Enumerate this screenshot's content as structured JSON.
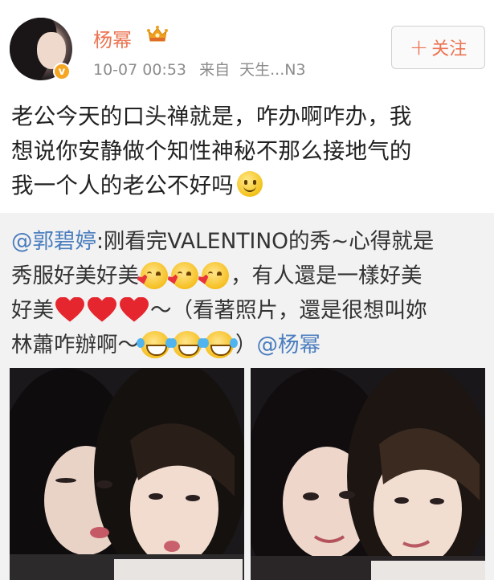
{
  "post": {
    "username": "杨幂",
    "time": "10-07 00:53",
    "from_label": "来自",
    "source": "天生...N3",
    "follow_label": "关注",
    "text_lines": [
      "老公今天的口头禅就是，咋办啊咋办，我",
      "想说你安静做个知性神秘不那么接地气的",
      "我一个人的老公不好吗"
    ]
  },
  "repost": {
    "mention_author": "@郭碧婷",
    "line1_text": ":刚看完VALENTINO的秀~心得就是",
    "line2_a": "秀服好美好美",
    "line2_b": "，有人還是一樣好美",
    "line3_a": "好美",
    "line3_b": "～（看著照片，還是很想叫妳",
    "line4_a": "林蕭咋辦啊～",
    "line4_b": "）",
    "mention_end": "@杨幂"
  },
  "icons": {
    "verified": "verified-v-badge",
    "vip": "vip-crown-icon",
    "smile": "smile-emoji",
    "kiss": "kiss-emoji",
    "heart": "heart-emoji",
    "laugh": "laugh-tears-emoji"
  },
  "colors": {
    "username": "#eb7350",
    "mention": "#4a7dbf",
    "meta": "#8c8c8c",
    "repost_bg": "#f2f2f2",
    "verified": "#f5a623"
  }
}
